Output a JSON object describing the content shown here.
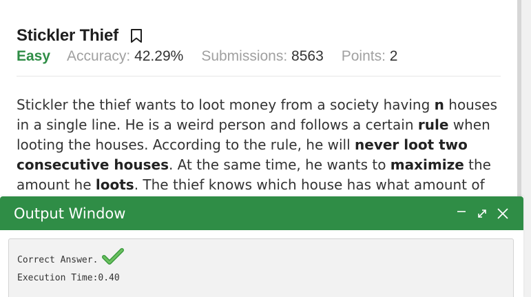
{
  "problem": {
    "title": "Stickler Thief",
    "difficulty": "Easy",
    "accuracy_label": "Accuracy: ",
    "accuracy_value": "42.29%",
    "submissions_label": "Submissions: ",
    "submissions_value": "8563",
    "points_label": "Points: ",
    "points_value": "2",
    "description": {
      "t1": "Stickler the thief wants to loot money from a society having ",
      "b1": "n",
      "t2": " houses in a single line. He is a weird person and follows a certain ",
      "b2": "rule",
      "t3": " when looting the houses. According to the rule, he will ",
      "b3": "never loot two consecutive houses",
      "t4": ". At the same time, he wants to ",
      "b4": "maximize",
      "t5": " the amount he ",
      "b5": "loots",
      "t6": ". The thief knows which house has what amount of"
    }
  },
  "output_window": {
    "title": "Output Window",
    "result_text": "Correct Answer.",
    "execution_time": "Execution Time:0.40"
  },
  "icons": {
    "bookmark": "bookmark-icon",
    "minimize": "minimize-icon",
    "expand": "expand-icon",
    "close": "close-icon",
    "check": "checkmark-icon"
  },
  "colors": {
    "accent_green": "#2f8d46",
    "muted_text": "#a0a0a0"
  }
}
